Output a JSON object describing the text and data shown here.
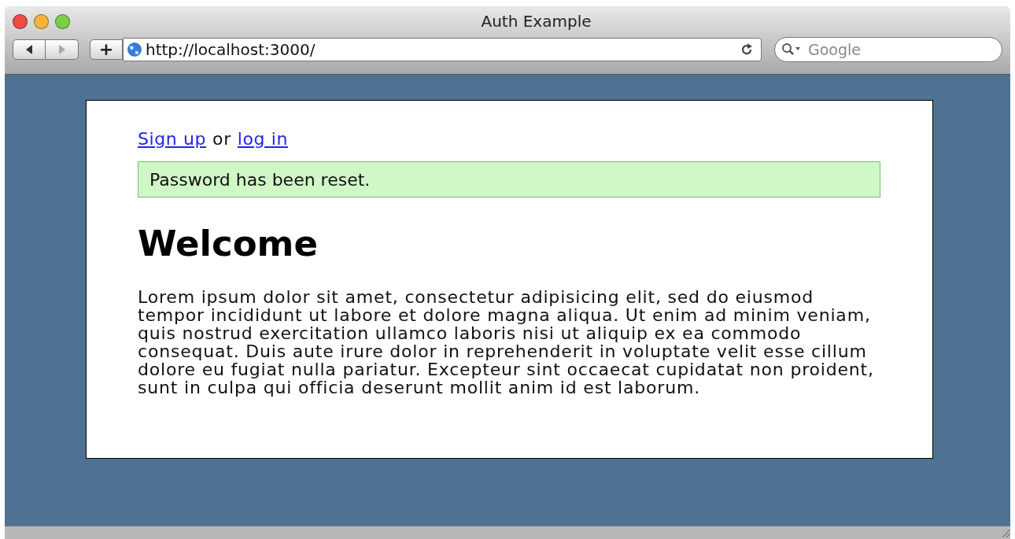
{
  "window": {
    "title": "Auth Example"
  },
  "toolbar": {
    "nav_buttons": [
      {
        "kind": "back",
        "disabled": false
      },
      {
        "kind": "forward",
        "disabled": true
      }
    ],
    "add_button": "+",
    "address": "http://localhost:3000/",
    "search": {
      "placeholder": "Google"
    }
  },
  "page": {
    "nav": {
      "links": [
        "Sign up",
        "log in"
      ],
      "separator": "or"
    },
    "flash": "Password has been reset.",
    "heading": "Welcome",
    "paragraph": "Lorem ipsum dolor sit amet, consectetur adipisicing elit, sed do eiusmod tempor incididunt ut labore et dolore magna aliqua. Ut enim ad minim veniam, quis nostrud exercitation ullamco laboris nisi ut aliquip ex ea commodo consequat. Duis aute irure dolor in reprehenderit in voluptate velit esse cillum dolore eu fugiat nulla pariatur. Excepteur sint occaecat cupidatat non proident, sunt in culpa qui officia deserunt mollit anim id est laborum."
  }
}
